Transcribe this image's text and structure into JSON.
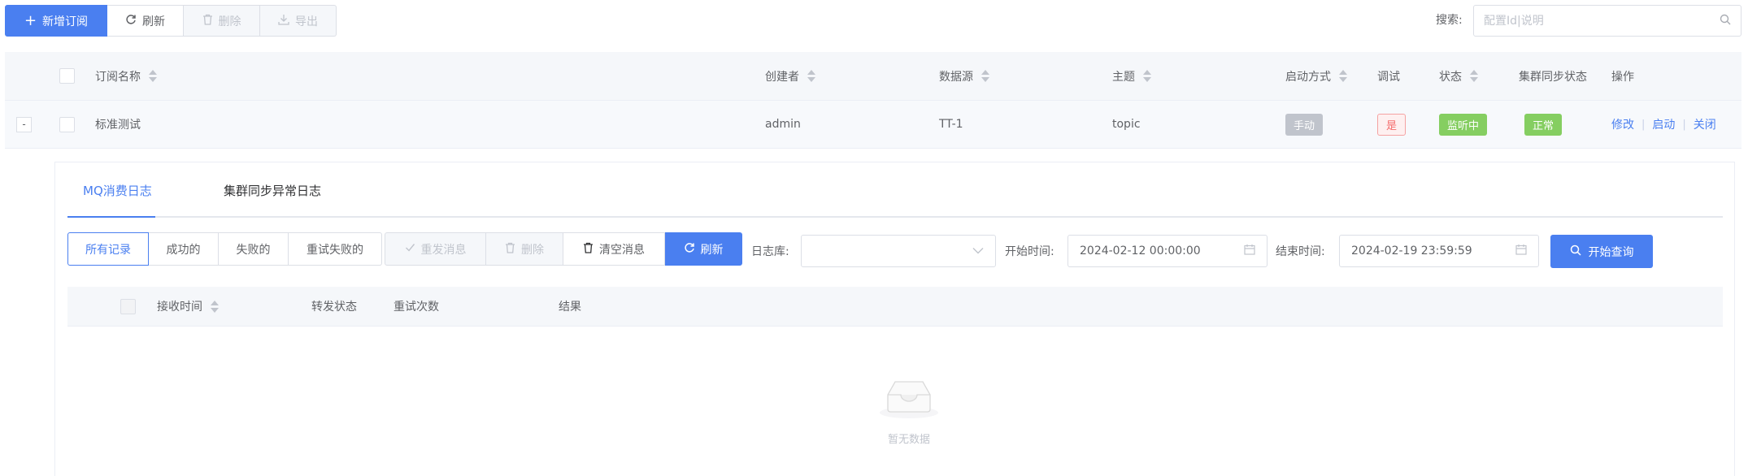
{
  "toolbar": {
    "add_label": "新增订阅",
    "refresh_label": "刷新",
    "delete_label": "删除",
    "export_label": "导出",
    "search_label": "搜索:",
    "search_placeholder": "配置Id|说明"
  },
  "table": {
    "headers": {
      "name": "订阅名称",
      "creator": "创建者",
      "datasource": "数据源",
      "topic": "主题",
      "start_mode": "启动方式",
      "debug": "调试",
      "status": "状态",
      "cluster_status": "集群同步状态",
      "actions": "操作"
    },
    "rows": [
      {
        "expand_symbol": "-",
        "name": "标准测试",
        "creator": "admin",
        "datasource": "TT-1",
        "topic": "topic",
        "start_mode": "手动",
        "debug": "是",
        "status": "监听中",
        "cluster_status": "正常",
        "action_edit": "修改",
        "action_start": "启动",
        "action_close": "关闭",
        "action_sep": "|"
      }
    ]
  },
  "detail": {
    "tabs": [
      "MQ消费日志",
      "集群同步异常日志"
    ],
    "filters": {
      "all": "所有记录",
      "success": "成功的",
      "failed": "失败的",
      "retry_failed": "重试失败的",
      "resend": "重发消息",
      "delete": "删除",
      "clear": "清空消息",
      "refresh": "刷新"
    },
    "log_db_label": "日志库:",
    "log_db_value": "",
    "start_time_label": "开始时间:",
    "start_time_value": "2024-02-12 00:00:00",
    "end_time_label": "结束时间:",
    "end_time_value": "2024-02-19 23:59:59",
    "query_label": "开始查询",
    "columns": {
      "receive_time": "接收时间",
      "forward_status": "转发状态",
      "retry_count": "重试次数",
      "result": "结果"
    },
    "empty_text": "暂无数据"
  },
  "colors": {
    "primary": "#4a7ff0",
    "tag_gray": "#c0c4cc",
    "tag_red": "#f56c6c",
    "tag_green": "#85ce61"
  }
}
